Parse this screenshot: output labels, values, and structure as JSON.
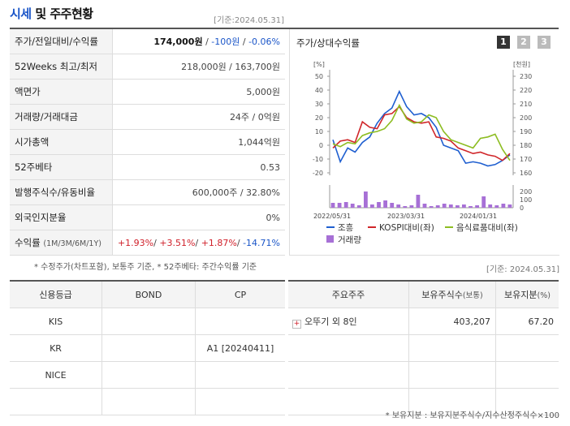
{
  "header": {
    "title_blue": "시세",
    "title_rest": " 및 주주현황",
    "date": "[기준:2024.05.31]"
  },
  "quote": {
    "rows": [
      {
        "label": "주가/전일대비/수익률",
        "price": "174,000원",
        "sep1": " / ",
        "change": "-100원",
        "sep2": " / ",
        "rate": "-0.06%"
      },
      {
        "label": "52Weeks 최고/최저",
        "value": "218,000원 / 163,700원"
      },
      {
        "label": "액면가",
        "value": "5,000원"
      },
      {
        "label": "거래량/거래대금",
        "value": "24주 / 0억원"
      },
      {
        "label": "시가총액",
        "value": "1,044억원"
      },
      {
        "label": "52주베타",
        "value": "0.53"
      },
      {
        "label": "발행주식수/유동비율",
        "value": "600,000주 / 32.80%"
      },
      {
        "label": "외국인지분율",
        "value": "0%"
      }
    ],
    "returns": {
      "label": "수익률",
      "label_small": "(1M/3M/6M/1Y)",
      "v1": "+1.93%",
      "v2": "+3.51%",
      "v3": "+1.87%",
      "v4": "-14.71%",
      "sep": "/ "
    }
  },
  "notes": {
    "left": "* 수정주가(차트포함), 보통주 기준, * 52주베타: 주간수익률 기준",
    "right": "[기준: 2024.05.31]",
    "bottom": "* 보유지분 : 보유지분주식수/지수산정주식수×100"
  },
  "chart": {
    "title": "주가/상대수익률",
    "pages": [
      "1",
      "2",
      "3"
    ]
  },
  "chart_data": {
    "type": "line",
    "left_unit": "[%]",
    "right_unit": "[천원]",
    "left_ticks": [
      50,
      40,
      30,
      20,
      10,
      0,
      -10,
      -20
    ],
    "right_ticks": [
      230,
      220,
      210,
      200,
      190,
      180,
      170,
      160
    ],
    "volume_ticks": [
      200,
      100,
      0
    ],
    "x_labels": [
      "2022/05/31",
      "2023/03/31",
      "2024/01/31"
    ],
    "ylim_left": [
      -20,
      50
    ],
    "ylim_right": [
      160,
      230
    ],
    "series": [
      {
        "name": "조흥",
        "color": "#1f5fd0",
        "axis": "right",
        "values": [
          184,
          168,
          178,
          175,
          182,
          186,
          196,
          203,
          207,
          219,
          208,
          202,
          203,
          200,
          193,
          180,
          178,
          176,
          167,
          168,
          167,
          165,
          166,
          169,
          173
        ]
      },
      {
        "name": "KOSPI대비(좌)",
        "color": "#d0262a",
        "axis": "left",
        "values": [
          -2,
          3,
          4,
          2,
          17,
          13,
          12,
          22,
          23,
          28,
          20,
          17,
          16,
          17,
          6,
          5,
          3,
          -2,
          -4,
          -6,
          -5,
          -7,
          -8,
          -11,
          -6
        ]
      },
      {
        "name": "음식료품대비(좌)",
        "color": "#8dbd22",
        "axis": "left",
        "values": [
          1,
          -1,
          2,
          1,
          7,
          9,
          10,
          12,
          18,
          29,
          19,
          16,
          17,
          22,
          20,
          10,
          4,
          2,
          0,
          -2,
          5,
          6,
          8,
          -3,
          -11
        ]
      },
      {
        "name": "거래량",
        "color": "#a770d6",
        "axis": "volume",
        "values": [
          60,
          60,
          70,
          50,
          30,
          200,
          40,
          70,
          90,
          60,
          40,
          20,
          30,
          160,
          50,
          20,
          30,
          50,
          40,
          30,
          40,
          20,
          30,
          140,
          40,
          30,
          50,
          40
        ]
      }
    ]
  },
  "credit": {
    "headers": [
      "신용등급",
      "BOND",
      "CP"
    ],
    "rows": [
      [
        "KIS",
        "",
        ""
      ],
      [
        "KR",
        "",
        "A1 [20240411]"
      ],
      [
        "NICE",
        "",
        ""
      ],
      [
        "",
        "",
        ""
      ]
    ]
  },
  "holders": {
    "headers": [
      "주요주주",
      "보유주식수",
      "(보통)",
      "보유지분",
      "(%)"
    ],
    "rows": [
      {
        "name": "오뚜기 외 8인",
        "shares": "403,207",
        "pct": "67.20"
      },
      {
        "name": "",
        "shares": "",
        "pct": ""
      },
      {
        "name": "",
        "shares": "",
        "pct": ""
      },
      {
        "name": "",
        "shares": "",
        "pct": ""
      }
    ]
  }
}
